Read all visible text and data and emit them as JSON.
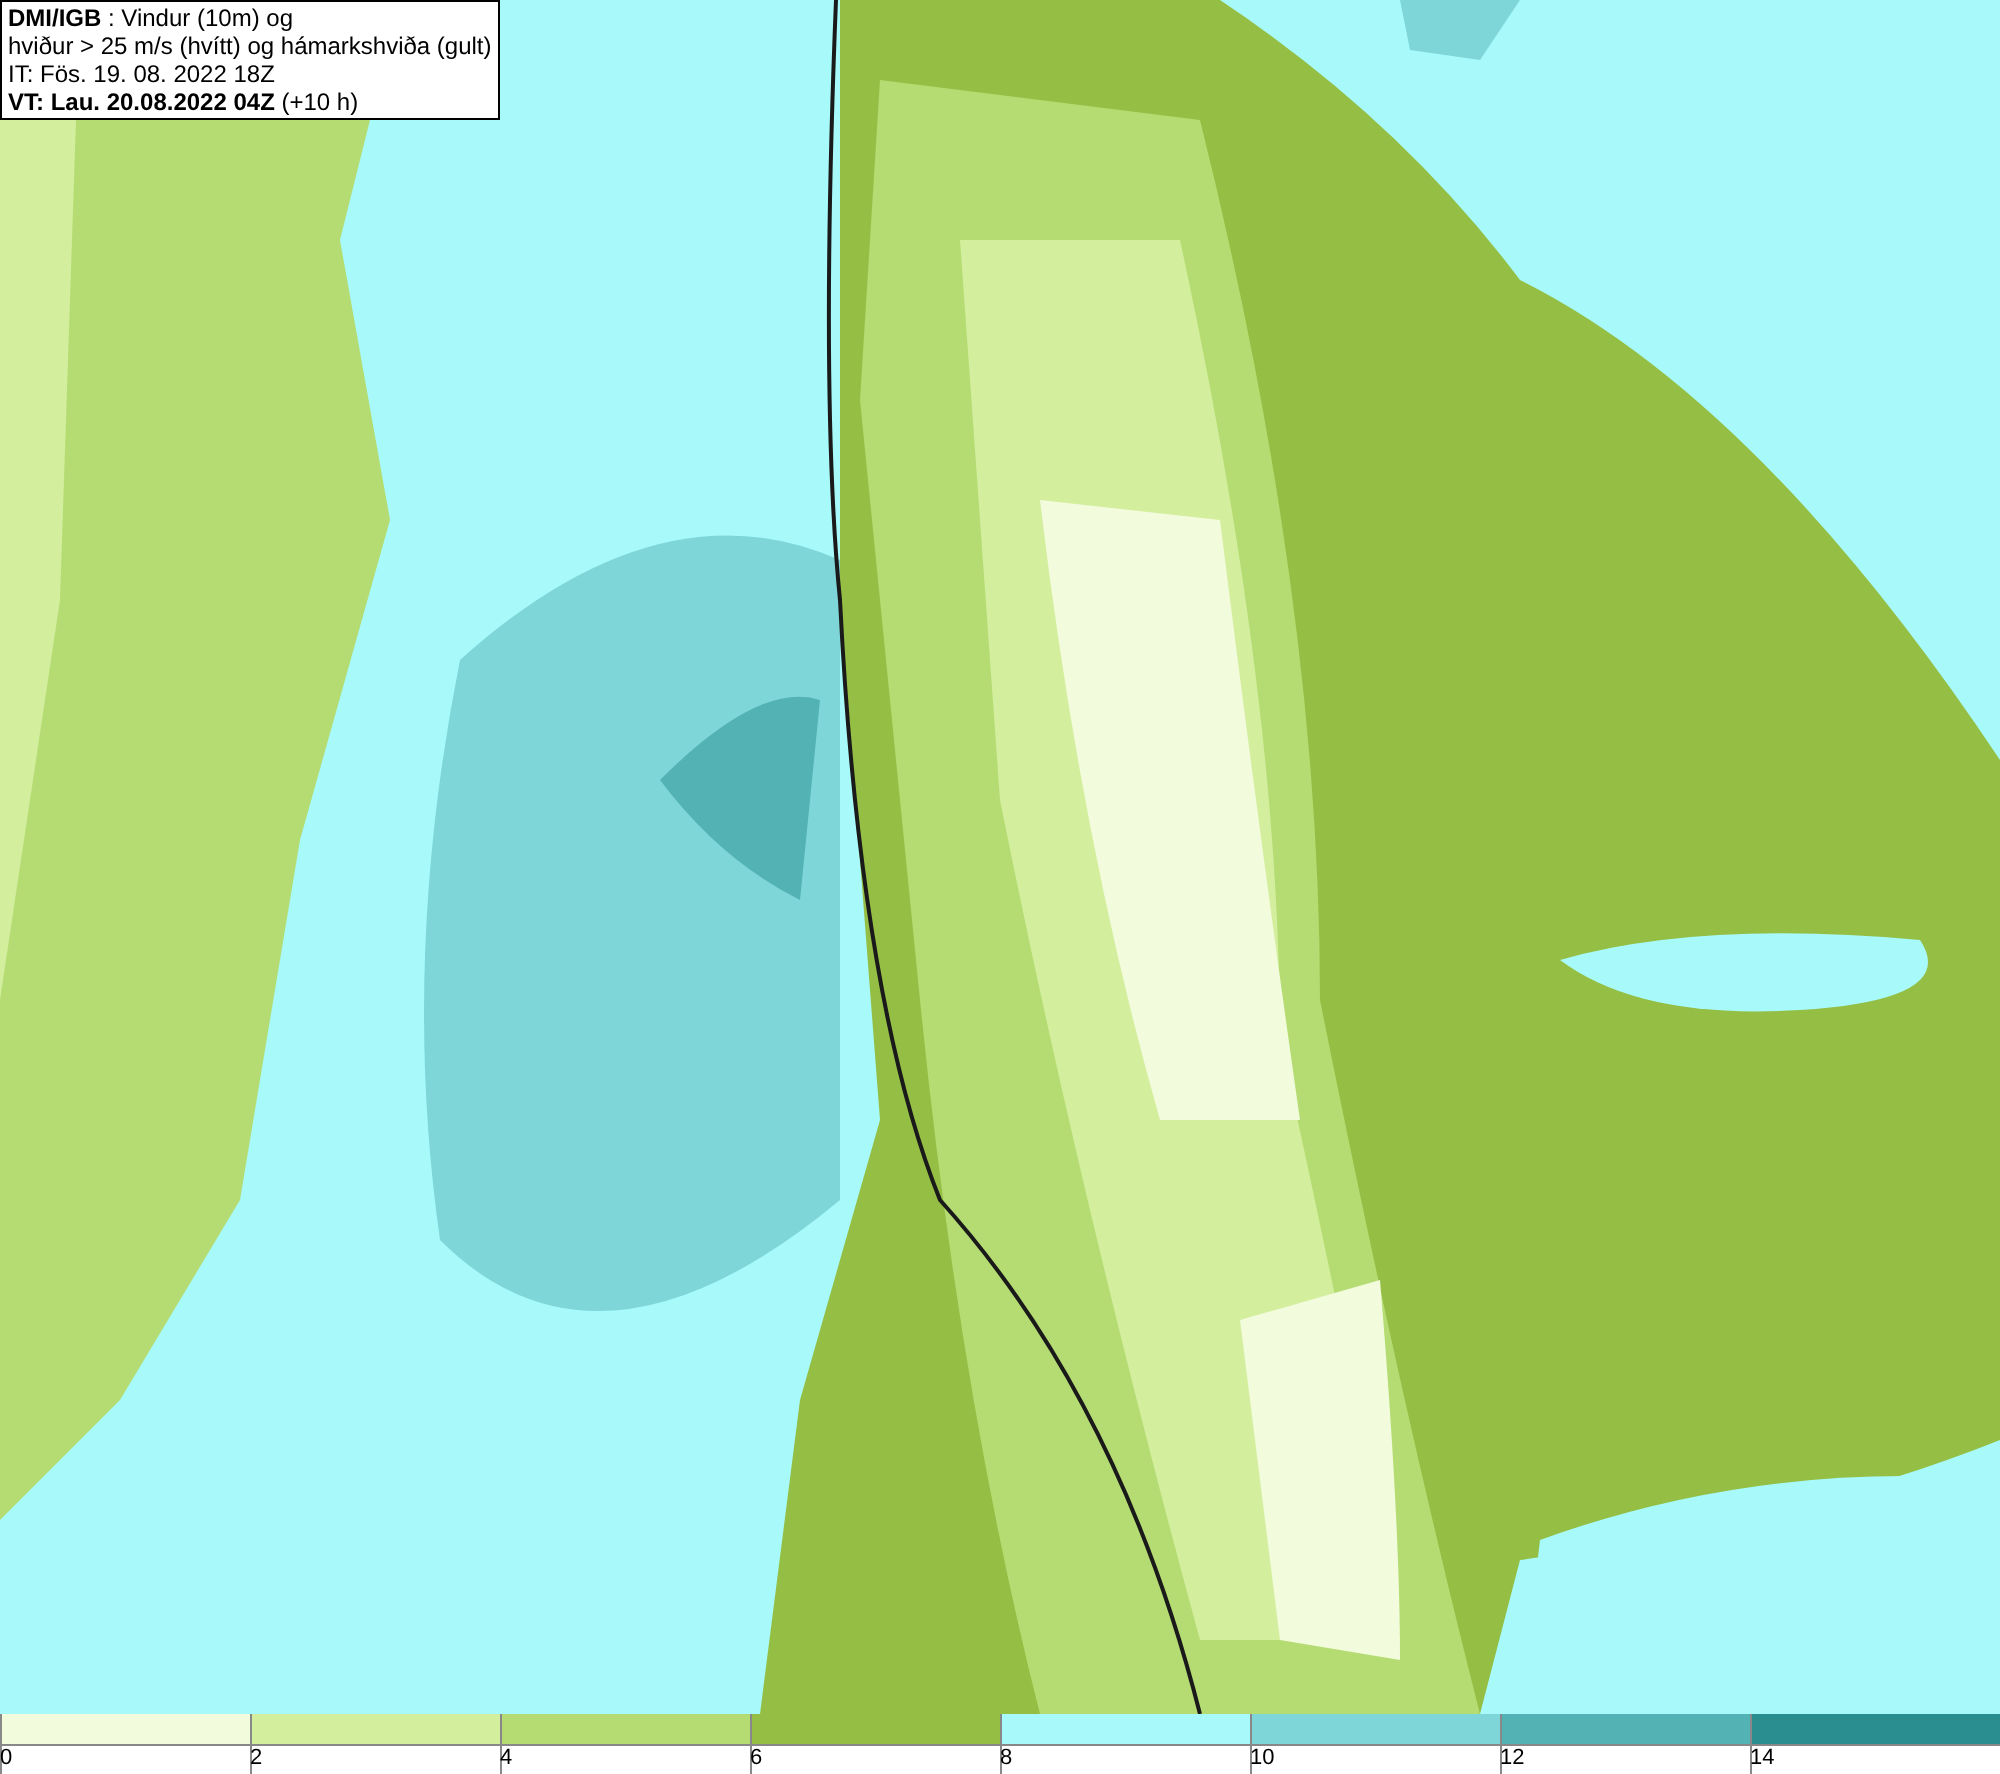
{
  "title_box": {
    "lines": [
      "**DMI/IGB** : Vindur (10m) og",
      "hviður > 25 m/s (hvítt) og hámarkshviða (gult)",
      "IT: Fös. 19. 08. 2022 18Z",
      "**VT: Lau. 20.08.2022 04Z** (+10 h)"
    ]
  },
  "colorbar": {
    "bins": [
      {
        "color": "#f2fbdc",
        "label": "0"
      },
      {
        "color": "#d3ee9d",
        "label": "2"
      },
      {
        "color": "#b4dc72",
        "label": "4"
      },
      {
        "color": "#94bf44",
        "label": "6"
      },
      {
        "color": "#a8fafa",
        "label": "8"
      },
      {
        "color": "#7fd6d8",
        "label": "10"
      },
      {
        "color": "#53b2b4",
        "label": "12"
      },
      {
        "color": "#2a8e90",
        "label": "14"
      }
    ]
  }
}
